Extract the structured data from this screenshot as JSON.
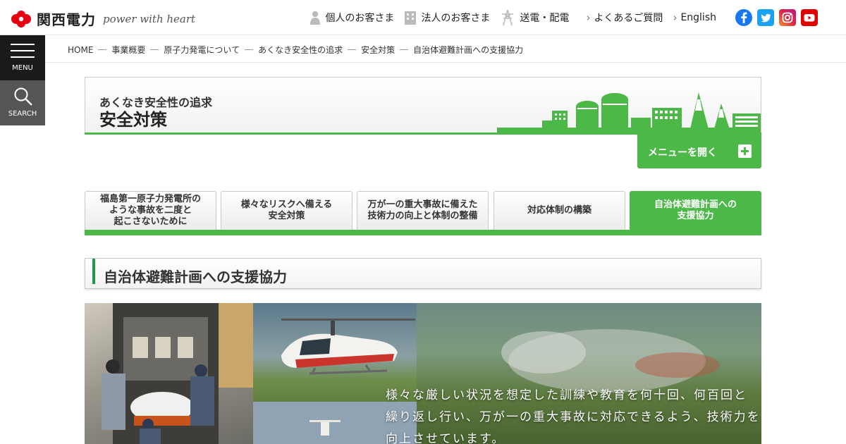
{
  "brand": {
    "name": "関西電力",
    "tagline": "power with heart",
    "color": "#e60012"
  },
  "header_nav": [
    {
      "label": "個人のお客さま",
      "icon": "person-icon"
    },
    {
      "label": "法人のお客さま",
      "icon": "building-icon"
    },
    {
      "label": "送電・配電",
      "icon": "power-tower-icon"
    },
    {
      "label": "よくあるご質問",
      "icon": "chevron-right-icon"
    },
    {
      "label": "English",
      "icon": "chevron-right-icon"
    }
  ],
  "social": [
    {
      "name": "facebook-icon",
      "color": "#1877f2"
    },
    {
      "name": "twitter-icon",
      "color": "#1da1f2"
    },
    {
      "name": "instagram-icon",
      "color": "#c13584"
    },
    {
      "name": "youtube-icon",
      "color": "#e00000"
    }
  ],
  "side": {
    "menu_label": "MENU",
    "search_label": "SEARCH"
  },
  "breadcrumb": [
    "HOME",
    "事業概要",
    "原子力発電について",
    "あくなき安全性の追求",
    "安全対策",
    "自治体避難計画への支援協力"
  ],
  "section": {
    "subtitle": "あくなき安全性の追求",
    "title": "安全対策",
    "menu_button": "メニューを開く",
    "accent": "#4cb848"
  },
  "tabs": [
    {
      "label": "福島第一原子力発電所のような事故を二度と起こさないために",
      "lines": [
        "福島第一原子力発電所の",
        "ような事故を二度と",
        "起こさないために"
      ],
      "active": false
    },
    {
      "label": "様々なリスクへ備える安全対策",
      "lines": [
        "様々なリスクへ備える",
        "安全対策"
      ],
      "active": false
    },
    {
      "label": "万が一の重大事故に備えた技術力の向上と体制の整備",
      "lines": [
        "万が一の重大事故に備えた",
        "技術力の向上と体制の整備"
      ],
      "active": false
    },
    {
      "label": "対応体制の構築",
      "lines": [
        "対応体制の構築"
      ],
      "active": false
    },
    {
      "label": "自治体避難計画への支援協力",
      "lines": [
        "自治体避難計画への",
        "支援協力"
      ],
      "active": true
    }
  ],
  "heading": "自治体避難計画への支援協力",
  "hero": {
    "copy_lines": [
      "様々な厳しい状況を想定した訓練や教育を何十回、何百回と",
      "繰り返し行い、万が一の重大事故に対応できるよう、技術力を",
      "向上させています。"
    ]
  }
}
